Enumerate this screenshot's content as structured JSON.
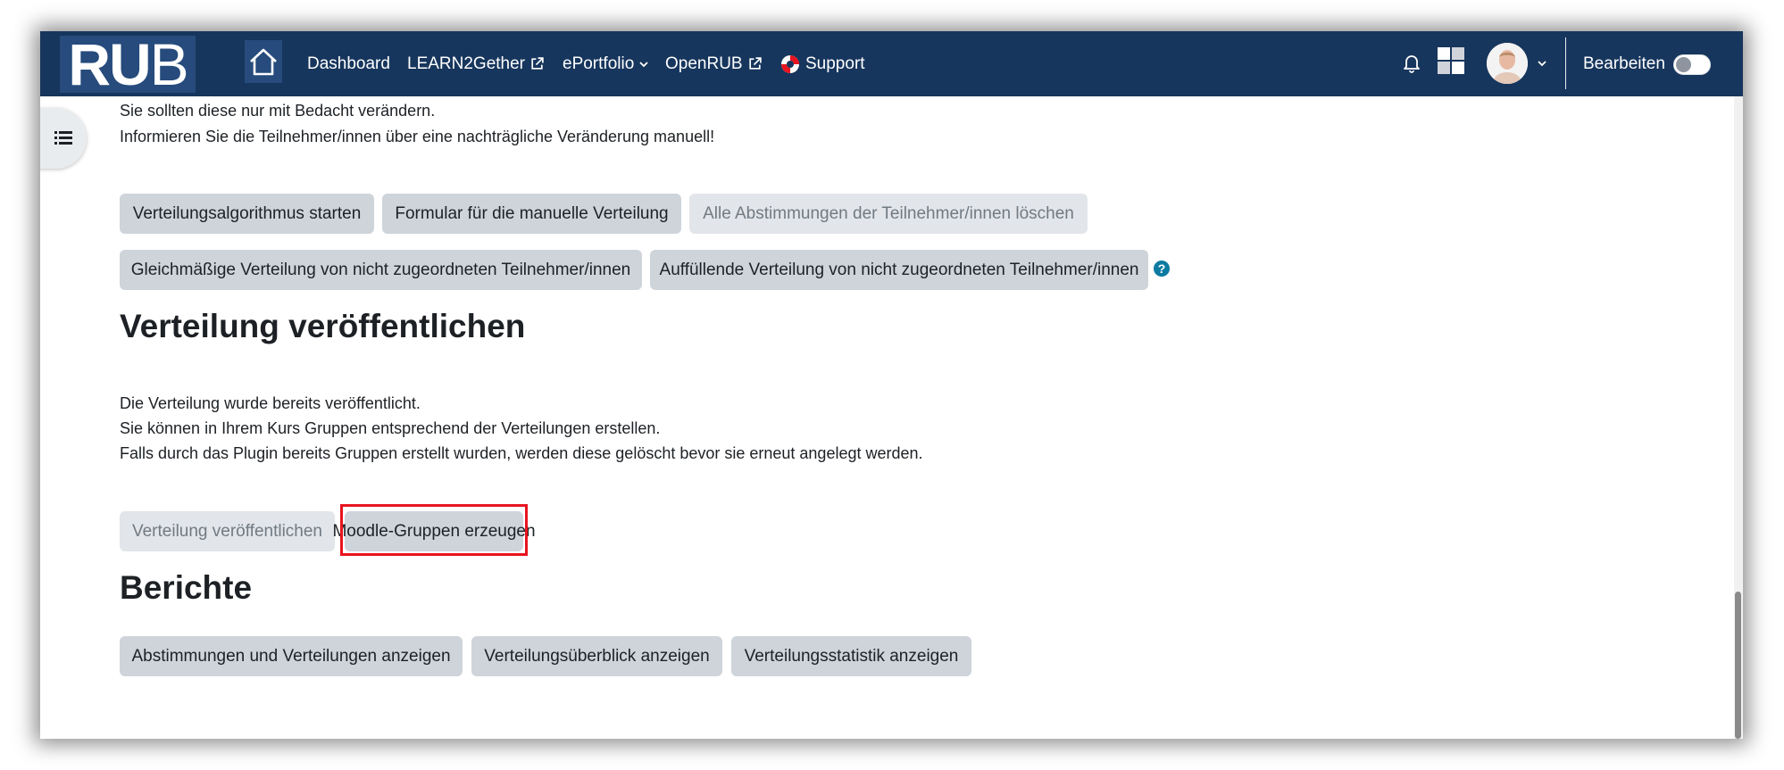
{
  "navbar": {
    "logo_text_bold": "RU",
    "logo_text_light": "B",
    "links": {
      "dashboard": "Dashboard",
      "learn2gether": "LEARN2Gether",
      "eportfolio": "ePortfolio",
      "openrub": "OpenRUB",
      "support": "Support"
    },
    "edit_label": "Bearbeiten"
  },
  "intro": {
    "line1": "Sie sollten diese nur mit Bedacht verändern.",
    "line2": "Informieren Sie die Teilnehmer/innen über eine nachträgliche Veränderung manuell!"
  },
  "actions": {
    "start_algorithm": "Verteilungsalgorithmus starten",
    "manual_form": "Formular für die manuelle Verteilung",
    "delete_votes": "Alle Abstimmungen der Teilnehmer/innen löschen",
    "even_distribution": "Gleichmäßige Verteilung von nicht zugeordneten Teilnehmer/innen",
    "fill_distribution": "Auffüllende Verteilung von nicht zugeordneten Teilnehmer/innen",
    "help_glyph": "?"
  },
  "publish": {
    "heading": "Verteilung veröffentlichen",
    "line1": "Die Verteilung wurde bereits veröffentlicht.",
    "line2": "Sie können in Ihrem Kurs Gruppen entsprechend der Verteilungen erstellen.",
    "line3": "Falls durch das Plugin bereits Gruppen erstellt wurden, werden diese gelöscht bevor sie erneut angelegt werden.",
    "publish_button": "Verteilung veröffentlichen",
    "create_groups_button": "Moodle-Gruppen erzeugen"
  },
  "reports": {
    "heading": "Berichte",
    "votes_button": "Abstimmungen und Verteilungen anzeigen",
    "overview_button": "Verteilungsüberblick anzeigen",
    "statistics_button": "Verteilungsstatistik anzeigen"
  },
  "colors": {
    "navbar_bg": "#17365d",
    "button_bg": "#ced4da",
    "highlight": "#e8141f"
  }
}
